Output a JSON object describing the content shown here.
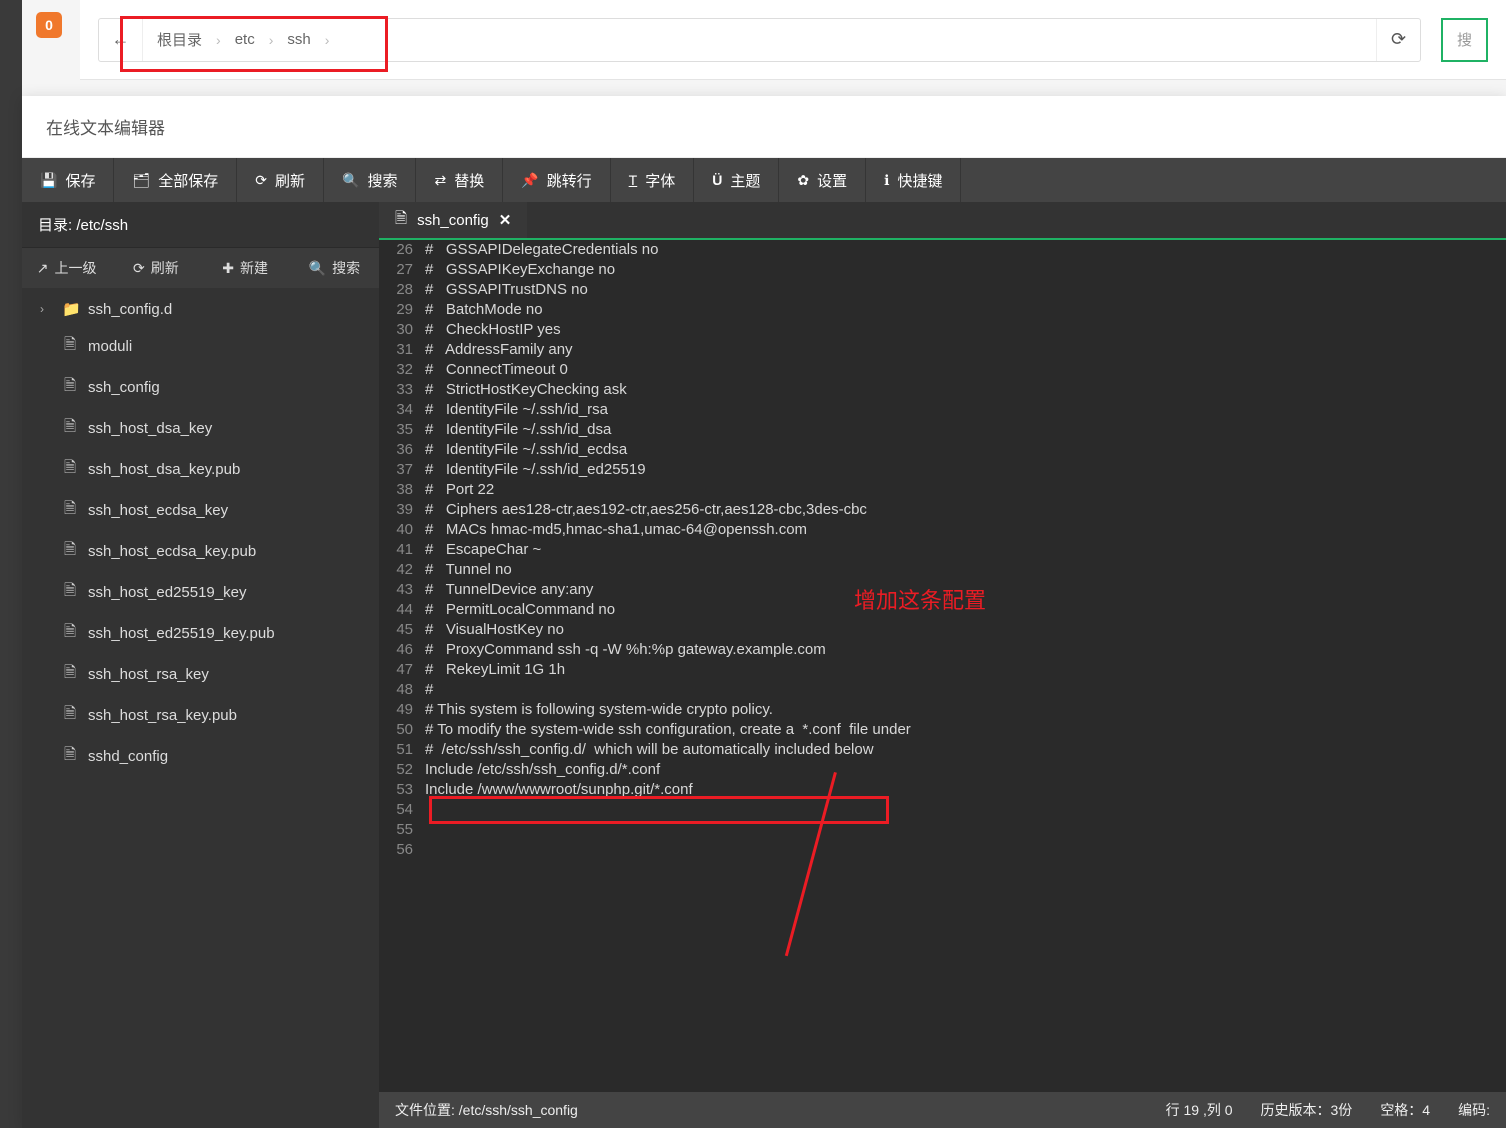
{
  "top_badge": "0",
  "breadcrumb": {
    "back": "←",
    "root": "根目录",
    "p1": "etc",
    "p2": "ssh",
    "sep": "›",
    "refresh": "⟳"
  },
  "search_top": "搜",
  "editor": {
    "title": "在线文本编辑器",
    "tools": {
      "save": "保存",
      "saveall": "全部保存",
      "refresh": "刷新",
      "search": "搜索",
      "replace": "替换",
      "jump": "跳转行",
      "font": "字体",
      "theme": "主题",
      "settings": "设置",
      "shortcut": "快捷键"
    },
    "dir_label": "目录:",
    "dir_path": "/etc/ssh",
    "side_tools": {
      "up": "上一级",
      "refresh": "刷新",
      "new": "新建",
      "search": "搜索"
    },
    "tree": [
      {
        "type": "folder",
        "name": "ssh_config.d",
        "chev": "›"
      },
      {
        "type": "file",
        "name": "moduli"
      },
      {
        "type": "file",
        "name": "ssh_config"
      },
      {
        "type": "file",
        "name": "ssh_host_dsa_key"
      },
      {
        "type": "file",
        "name": "ssh_host_dsa_key.pub"
      },
      {
        "type": "file",
        "name": "ssh_host_ecdsa_key"
      },
      {
        "type": "file",
        "name": "ssh_host_ecdsa_key.pub"
      },
      {
        "type": "file",
        "name": "ssh_host_ed25519_key"
      },
      {
        "type": "file",
        "name": "ssh_host_ed25519_key.pub"
      },
      {
        "type": "file",
        "name": "ssh_host_rsa_key"
      },
      {
        "type": "file",
        "name": "ssh_host_rsa_key.pub"
      },
      {
        "type": "file",
        "name": "sshd_config"
      }
    ],
    "tab": {
      "name": "ssh_config",
      "close": "✕"
    },
    "code_start": 26,
    "code": [
      "#   GSSAPIDelegateCredentials no",
      "#   GSSAPIKeyExchange no",
      "#   GSSAPITrustDNS no",
      "#   BatchMode no",
      "#   CheckHostIP yes",
      "#   AddressFamily any",
      "#   ConnectTimeout 0",
      "#   StrictHostKeyChecking ask",
      "#   IdentityFile ~/.ssh/id_rsa",
      "#   IdentityFile ~/.ssh/id_dsa",
      "#   IdentityFile ~/.ssh/id_ecdsa",
      "#   IdentityFile ~/.ssh/id_ed25519",
      "#   Port 22",
      "#   Ciphers aes128-ctr,aes192-ctr,aes256-ctr,aes128-cbc,3des-cbc",
      "#   MACs hmac-md5,hmac-sha1,umac-64@openssh.com",
      "#   EscapeChar ~",
      "#   Tunnel no",
      "#   TunnelDevice any:any",
      "#   PermitLocalCommand no",
      "#   VisualHostKey no",
      "#   ProxyCommand ssh -q -W %h:%p gateway.example.com",
      "#   RekeyLimit 1G 1h",
      "#",
      "# This system is following system-wide crypto policy.",
      "# To modify the system-wide ssh configuration, create a  *.conf  file under",
      "#  /etc/ssh/ssh_config.d/  which will be automatically included below",
      "Include /etc/ssh/ssh_config.d/*.conf",
      "Include /www/wwwroot/sunphp.git/*.conf",
      "",
      "",
      ""
    ],
    "status": {
      "file_label": "文件位置:",
      "file": "/etc/ssh/ssh_config",
      "pos": "行 19 ,列 0",
      "history": "历史版本：3份",
      "space": "空格：4",
      "encoding": "编码:"
    }
  },
  "annotations": {
    "note": "增加这条配置"
  }
}
